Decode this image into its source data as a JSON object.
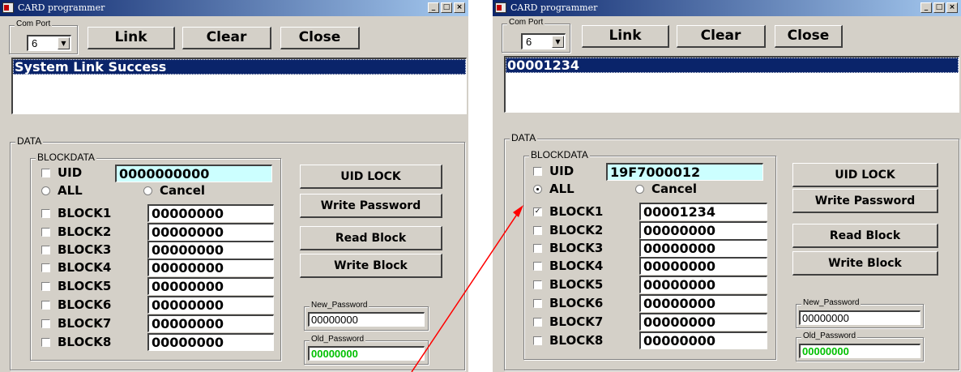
{
  "windows": [
    {
      "title": "CARD programmer",
      "com_port": {
        "label": "Com Port",
        "value": "6"
      },
      "buttons": {
        "link": "Link",
        "clear": "Clear",
        "close": "Close"
      },
      "log_selected": "System Link Success",
      "data_group": "DATA",
      "blockdata_group": "BLOCKDATA",
      "uid": {
        "label": "UID",
        "value": "0000000000",
        "checked": false
      },
      "radio": {
        "all": "ALL",
        "cancel": "Cancel",
        "all_selected": false
      },
      "blocks": [
        {
          "label": "BLOCK1",
          "value": "00000000",
          "checked": false
        },
        {
          "label": "BLOCK2",
          "value": "00000000",
          "checked": false
        },
        {
          "label": "BLOCK3",
          "value": "00000000",
          "checked": false
        },
        {
          "label": "BLOCK4",
          "value": "00000000",
          "checked": false
        },
        {
          "label": "BLOCK5",
          "value": "00000000",
          "checked": false
        },
        {
          "label": "BLOCK6",
          "value": "00000000",
          "checked": false
        },
        {
          "label": "BLOCK7",
          "value": "00000000",
          "checked": false
        },
        {
          "label": "BLOCK8",
          "value": "00000000",
          "checked": false
        }
      ],
      "actions": {
        "uid_lock": "UID LOCK",
        "write_password": "Write Password",
        "read_block": "Read Block",
        "write_block": "Write Block"
      },
      "new_password": {
        "label": "New_Password",
        "value": "00000000"
      },
      "old_password": {
        "label": "Old_Password",
        "value": "00000000"
      }
    },
    {
      "title": "CARD programmer",
      "com_port": {
        "label": "Com Port",
        "value": "6"
      },
      "buttons": {
        "link": "Link",
        "clear": "Clear",
        "close": "Close"
      },
      "log_selected": "00001234",
      "data_group": "DATA",
      "blockdata_group": "BLOCKDATA",
      "uid": {
        "label": "UID",
        "value": "19F7000012",
        "checked": false
      },
      "radio": {
        "all": "ALL",
        "cancel": "Cancel",
        "all_selected": true
      },
      "blocks": [
        {
          "label": "BLOCK1",
          "value": "00001234",
          "checked": true
        },
        {
          "label": "BLOCK2",
          "value": "00000000",
          "checked": false
        },
        {
          "label": "BLOCK3",
          "value": "00000000",
          "checked": false
        },
        {
          "label": "BLOCK4",
          "value": "00000000",
          "checked": false
        },
        {
          "label": "BLOCK5",
          "value": "00000000",
          "checked": false
        },
        {
          "label": "BLOCK6",
          "value": "00000000",
          "checked": false
        },
        {
          "label": "BLOCK7",
          "value": "00000000",
          "checked": false
        },
        {
          "label": "BLOCK8",
          "value": "00000000",
          "checked": false
        }
      ],
      "actions": {
        "uid_lock": "UID LOCK",
        "write_password": "Write Password",
        "read_block": "Read Block",
        "write_block": "Write Block"
      },
      "new_password": {
        "label": "New_Password",
        "value": "00000000"
      },
      "old_password": {
        "label": "Old_Password",
        "value": "00000000"
      }
    }
  ],
  "annotation_color": "#ff0000"
}
